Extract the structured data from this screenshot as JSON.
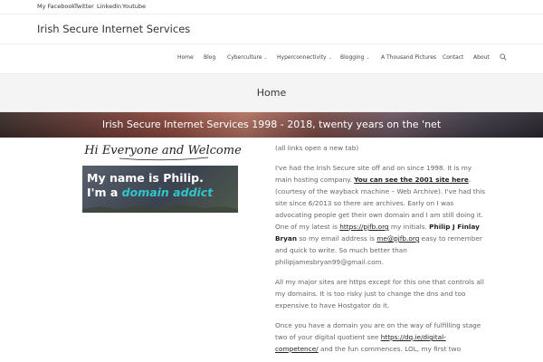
{
  "topbar": {
    "links": [
      "My Facebook",
      "Twitter",
      "Linkedin",
      "Youtube"
    ]
  },
  "site": {
    "title": "Irish Secure Internet Services"
  },
  "nav": {
    "items": [
      "Home",
      "Blog",
      "Cyberculture",
      "Hyperconnectivity",
      "Blogging",
      "A Thousand Pictures",
      "Contact",
      "About"
    ],
    "has_dropdown": [
      false,
      false,
      true,
      true,
      true,
      false,
      false,
      false
    ]
  },
  "page": {
    "title": "Home"
  },
  "banner": {
    "title": "Irish Secure Internet Services 1998 - 2018, twenty years on the 'net"
  },
  "welcome": {
    "text": "Hi Everyone and Welcome"
  },
  "promo": {
    "line1": "My name is Philip.",
    "line2_prefix": "I'm a ",
    "line2_accent": "domain addict"
  },
  "content": {
    "p0": "(all links open a new tab)",
    "p1_a": "I've had the Irish Secure site off and on since 1998. It is my main hosting company.  ",
    "p1_link1": "You can see the 2001 site here",
    "p1_b": ". (courtesy of the wayback machine – Web Archive).  I've had this site since 6/2013 so there are archives. Early on I was advocating people get their own domain and I am still doing it. One of my latest is ",
    "p1_link2": "https://pjfb.org",
    "p1_c": " my initials. ",
    "p1_name": "Philip J Finlay Bryan",
    "p1_d": " so my email address is ",
    "p1_email": "me@pjfb.org",
    "p1_e": " easy to remember and quick to write.  So much better than philipjamesbryan99@gmail.com.",
    "p2": "All my major sites are https except for this one that controls all my domains. It is too risky just to change the dns and too expensive to have Hostgator do it.",
    "p3_a": "Once you have a domain you are on the way of fulfilling stage two of your digital quotient see ",
    "p3_link": "https://dq.ie/digital-competence/",
    "p3_b": " and the fun commences. LOL, my first two"
  },
  "colors": {
    "accent": "#2ec6c9",
    "hero_bg": "#f4f4f4",
    "text": "#666666",
    "link": "#222222"
  }
}
